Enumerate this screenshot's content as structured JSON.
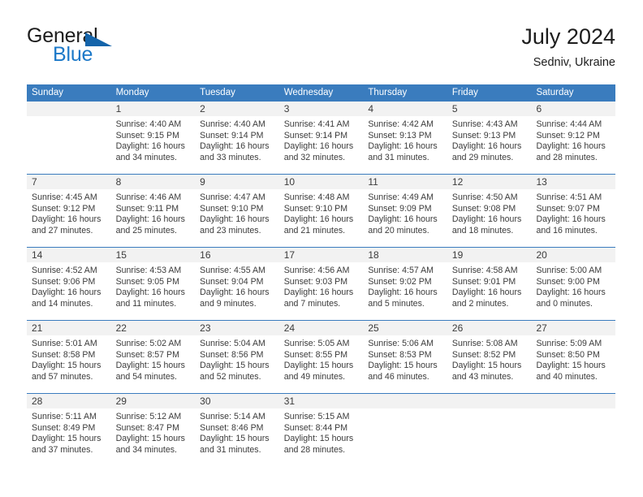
{
  "brand": {
    "name_part1": "General",
    "name_part2": "Blue",
    "triangle_color": "#1464aa",
    "blue_color": "#1b78c8"
  },
  "header": {
    "title": "July 2024",
    "subtitle": "Sedniv, Ukraine"
  },
  "theme": {
    "header_bg": "#3a7cbe",
    "header_text": "#ffffff",
    "daynum_bg": "#f2f2f2",
    "body_text": "#3b3b3b"
  },
  "weekdays": [
    "Sunday",
    "Monday",
    "Tuesday",
    "Wednesday",
    "Thursday",
    "Friday",
    "Saturday"
  ],
  "weeks": [
    [
      {
        "day": "",
        "lines": []
      },
      {
        "day": "1",
        "lines": [
          "Sunrise: 4:40 AM",
          "Sunset: 9:15 PM",
          "Daylight: 16 hours",
          "and 34 minutes."
        ]
      },
      {
        "day": "2",
        "lines": [
          "Sunrise: 4:40 AM",
          "Sunset: 9:14 PM",
          "Daylight: 16 hours",
          "and 33 minutes."
        ]
      },
      {
        "day": "3",
        "lines": [
          "Sunrise: 4:41 AM",
          "Sunset: 9:14 PM",
          "Daylight: 16 hours",
          "and 32 minutes."
        ]
      },
      {
        "day": "4",
        "lines": [
          "Sunrise: 4:42 AM",
          "Sunset: 9:13 PM",
          "Daylight: 16 hours",
          "and 31 minutes."
        ]
      },
      {
        "day": "5",
        "lines": [
          "Sunrise: 4:43 AM",
          "Sunset: 9:13 PM",
          "Daylight: 16 hours",
          "and 29 minutes."
        ]
      },
      {
        "day": "6",
        "lines": [
          "Sunrise: 4:44 AM",
          "Sunset: 9:12 PM",
          "Daylight: 16 hours",
          "and 28 minutes."
        ]
      }
    ],
    [
      {
        "day": "7",
        "lines": [
          "Sunrise: 4:45 AM",
          "Sunset: 9:12 PM",
          "Daylight: 16 hours",
          "and 27 minutes."
        ]
      },
      {
        "day": "8",
        "lines": [
          "Sunrise: 4:46 AM",
          "Sunset: 9:11 PM",
          "Daylight: 16 hours",
          "and 25 minutes."
        ]
      },
      {
        "day": "9",
        "lines": [
          "Sunrise: 4:47 AM",
          "Sunset: 9:10 PM",
          "Daylight: 16 hours",
          "and 23 minutes."
        ]
      },
      {
        "day": "10",
        "lines": [
          "Sunrise: 4:48 AM",
          "Sunset: 9:10 PM",
          "Daylight: 16 hours",
          "and 21 minutes."
        ]
      },
      {
        "day": "11",
        "lines": [
          "Sunrise: 4:49 AM",
          "Sunset: 9:09 PM",
          "Daylight: 16 hours",
          "and 20 minutes."
        ]
      },
      {
        "day": "12",
        "lines": [
          "Sunrise: 4:50 AM",
          "Sunset: 9:08 PM",
          "Daylight: 16 hours",
          "and 18 minutes."
        ]
      },
      {
        "day": "13",
        "lines": [
          "Sunrise: 4:51 AM",
          "Sunset: 9:07 PM",
          "Daylight: 16 hours",
          "and 16 minutes."
        ]
      }
    ],
    [
      {
        "day": "14",
        "lines": [
          "Sunrise: 4:52 AM",
          "Sunset: 9:06 PM",
          "Daylight: 16 hours",
          "and 14 minutes."
        ]
      },
      {
        "day": "15",
        "lines": [
          "Sunrise: 4:53 AM",
          "Sunset: 9:05 PM",
          "Daylight: 16 hours",
          "and 11 minutes."
        ]
      },
      {
        "day": "16",
        "lines": [
          "Sunrise: 4:55 AM",
          "Sunset: 9:04 PM",
          "Daylight: 16 hours",
          "and 9 minutes."
        ]
      },
      {
        "day": "17",
        "lines": [
          "Sunrise: 4:56 AM",
          "Sunset: 9:03 PM",
          "Daylight: 16 hours",
          "and 7 minutes."
        ]
      },
      {
        "day": "18",
        "lines": [
          "Sunrise: 4:57 AM",
          "Sunset: 9:02 PM",
          "Daylight: 16 hours",
          "and 5 minutes."
        ]
      },
      {
        "day": "19",
        "lines": [
          "Sunrise: 4:58 AM",
          "Sunset: 9:01 PM",
          "Daylight: 16 hours",
          "and 2 minutes."
        ]
      },
      {
        "day": "20",
        "lines": [
          "Sunrise: 5:00 AM",
          "Sunset: 9:00 PM",
          "Daylight: 16 hours",
          "and 0 minutes."
        ]
      }
    ],
    [
      {
        "day": "21",
        "lines": [
          "Sunrise: 5:01 AM",
          "Sunset: 8:58 PM",
          "Daylight: 15 hours",
          "and 57 minutes."
        ]
      },
      {
        "day": "22",
        "lines": [
          "Sunrise: 5:02 AM",
          "Sunset: 8:57 PM",
          "Daylight: 15 hours",
          "and 54 minutes."
        ]
      },
      {
        "day": "23",
        "lines": [
          "Sunrise: 5:04 AM",
          "Sunset: 8:56 PM",
          "Daylight: 15 hours",
          "and 52 minutes."
        ]
      },
      {
        "day": "24",
        "lines": [
          "Sunrise: 5:05 AM",
          "Sunset: 8:55 PM",
          "Daylight: 15 hours",
          "and 49 minutes."
        ]
      },
      {
        "day": "25",
        "lines": [
          "Sunrise: 5:06 AM",
          "Sunset: 8:53 PM",
          "Daylight: 15 hours",
          "and 46 minutes."
        ]
      },
      {
        "day": "26",
        "lines": [
          "Sunrise: 5:08 AM",
          "Sunset: 8:52 PM",
          "Daylight: 15 hours",
          "and 43 minutes."
        ]
      },
      {
        "day": "27",
        "lines": [
          "Sunrise: 5:09 AM",
          "Sunset: 8:50 PM",
          "Daylight: 15 hours",
          "and 40 minutes."
        ]
      }
    ],
    [
      {
        "day": "28",
        "lines": [
          "Sunrise: 5:11 AM",
          "Sunset: 8:49 PM",
          "Daylight: 15 hours",
          "and 37 minutes."
        ]
      },
      {
        "day": "29",
        "lines": [
          "Sunrise: 5:12 AM",
          "Sunset: 8:47 PM",
          "Daylight: 15 hours",
          "and 34 minutes."
        ]
      },
      {
        "day": "30",
        "lines": [
          "Sunrise: 5:14 AM",
          "Sunset: 8:46 PM",
          "Daylight: 15 hours",
          "and 31 minutes."
        ]
      },
      {
        "day": "31",
        "lines": [
          "Sunrise: 5:15 AM",
          "Sunset: 8:44 PM",
          "Daylight: 15 hours",
          "and 28 minutes."
        ]
      },
      {
        "day": "",
        "lines": []
      },
      {
        "day": "",
        "lines": []
      },
      {
        "day": "",
        "lines": []
      }
    ]
  ]
}
